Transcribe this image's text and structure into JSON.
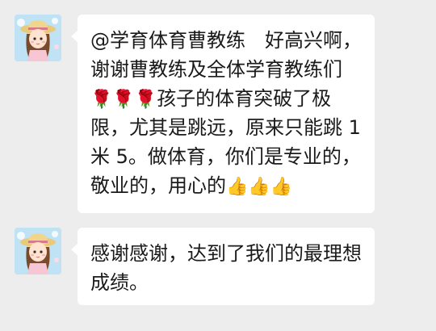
{
  "chat": {
    "messages": [
      {
        "avatar_icon": "girl-straw-hat-avatar-icon",
        "text_part1": "@学育体育曹教练 好高兴啊，谢谢曹教练及全体学育教练们",
        "emoji_roses": "🌹🌹🌹",
        "text_part2": "孩子的体育突破了极限，尤其是跳远，原来只能跳 1 米 5。做体育，你们是专业的，敬业的，用心的",
        "emoji_thumbs": "👍👍👍"
      },
      {
        "avatar_icon": "girl-straw-hat-avatar-icon",
        "text": "感谢感谢，达到了我们的最理想成绩。"
      }
    ]
  },
  "colors": {
    "background": "#ededed",
    "bubble": "#ffffff",
    "text": "#1a1a1a"
  }
}
